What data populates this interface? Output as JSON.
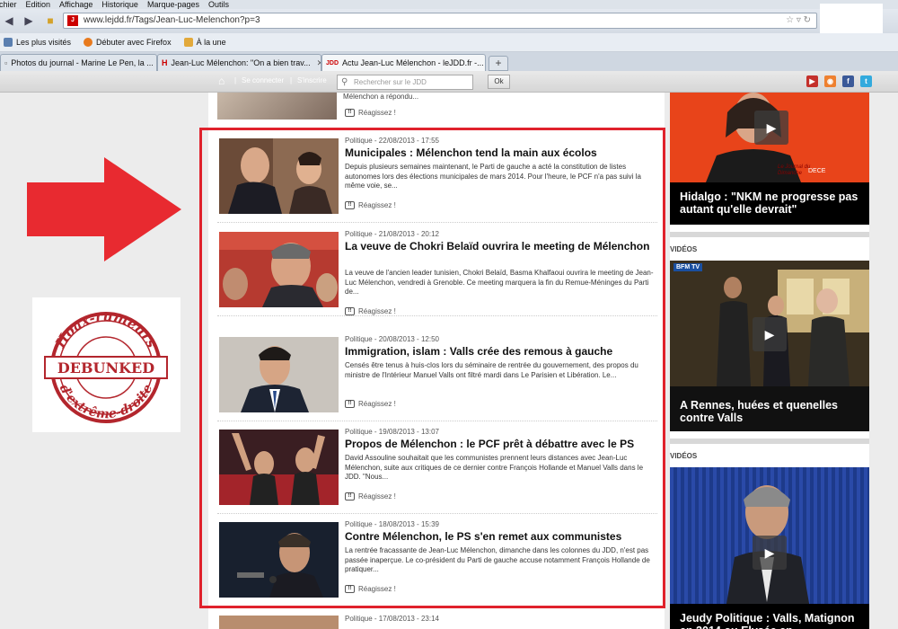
{
  "browser": {
    "menu": [
      "ichier",
      "Edition",
      "Affichage",
      "Historique",
      "Marque-pages",
      "Outils"
    ],
    "url": "www.lejdd.fr/Tags/Jean-Luc-Melenchon?p=3",
    "bookmarks": [
      "Les plus visités",
      "Débuter avec Firefox",
      "À la une"
    ],
    "tabs": [
      {
        "label": "Photos du journal - Marine Le Pen, la ..."
      },
      {
        "label": "Jean-Luc Mélenchon: \"On a bien trav..."
      },
      {
        "label": "Actu Jean-Luc Mélenchon - leJDD.fr -...",
        "active": true
      }
    ]
  },
  "site": {
    "connect": "Se connecter",
    "register": "S'inscrire",
    "search_placeholder": "Rechercher sur le JDD",
    "ok": "Ok",
    "social": [
      "youtube-icon",
      "rss-icon",
      "facebook-icon",
      "twitter-icon"
    ]
  },
  "top_snippet": {
    "text": "Mélenchon a répondu...",
    "react": "Réagissez !"
  },
  "articles": [
    {
      "meta": "Politique - 22/08/2013 - 17:55",
      "title": "Municipales : Mélenchon tend la main aux écolos",
      "summary": "Depuis plusieurs semaines maintenant, le Parti de gauche a acté la constitution de listes autonomes lors des élections municipales de mars 2014. Pour l'heure, le PCF n'a pas suivi la même voie, se...",
      "react": "Réagissez !"
    },
    {
      "meta": "Politique - 21/08/2013 - 20:12",
      "title": "La veuve de Chokri Belaïd ouvrira le meeting de Mélenchon",
      "summary": "La veuve de l'ancien leader tunisien, Chokri Belaïd,  Basma Khalfaoui ouvrira le meeting de Jean-Luc Mélenchon, vendredi à Grenoble. Ce meeting marquera la fin du Remue-Méninges du Parti de...",
      "react": "Réagissez !"
    },
    {
      "meta": "Politique - 20/08/2013 - 12:50",
      "title": "Immigration, islam : Valls crée des remous à gauche",
      "summary": "Censés être tenus à huis-clos lors du séminaire de rentrée du gouvernement, des propos du ministre de l'Intérieur Manuel Valls ont filtré mardi dans Le Parisien et Libération.  Le...",
      "react": "Réagissez !"
    },
    {
      "meta": "Politique - 19/08/2013 - 13:07",
      "title": "Propos de Mélenchon : le PCF prêt à débattre avec le PS",
      "summary": "David Assouline souhaitait que les communistes prennent leurs distances avec Jean-Luc Mélenchon, suite aux critiques de ce dernier contre François Hollande et Manuel Valls dans le JDD. \"Nous...",
      "react": "Réagissez !"
    },
    {
      "meta": "Politique - 18/08/2013 - 15:39",
      "title": "Contre Mélenchon, le PS s'en remet aux communistes",
      "summary": "La rentrée fracassante de Jean-Luc Mélenchon, dimanche dans les colonnes du JDD, n'est pas passée inaperçue. Le co-président du Parti de gauche accuse notamment François Hollande de pratiquer...",
      "react": "Réagissez !"
    }
  ],
  "bottom_meta": "Politique - 17/08/2013 - 23:14",
  "sidebar": {
    "videos_label": "VIDÉOS",
    "video1_caption": "Hidalgo : \"NKM ne progresse pas autant qu'elle devrait\"",
    "video2_caption": "A Rennes, huées et quenelles contre Valls",
    "video3_caption": "Jeudy Politique : Valls, Matignon en 2014 ou Elysée en",
    "jdd_overlay": "Le Journal du Dimanche",
    "dece": "DECE",
    "bfm": "BFM TV"
  },
  "logo": {
    "top": "Hoax-rumeurs",
    "middle": "DEBUNKED",
    "bottom": "d'extrême-droite"
  },
  "colors": {
    "highlight": "#e0222c",
    "logo_red": "#b3262d"
  }
}
